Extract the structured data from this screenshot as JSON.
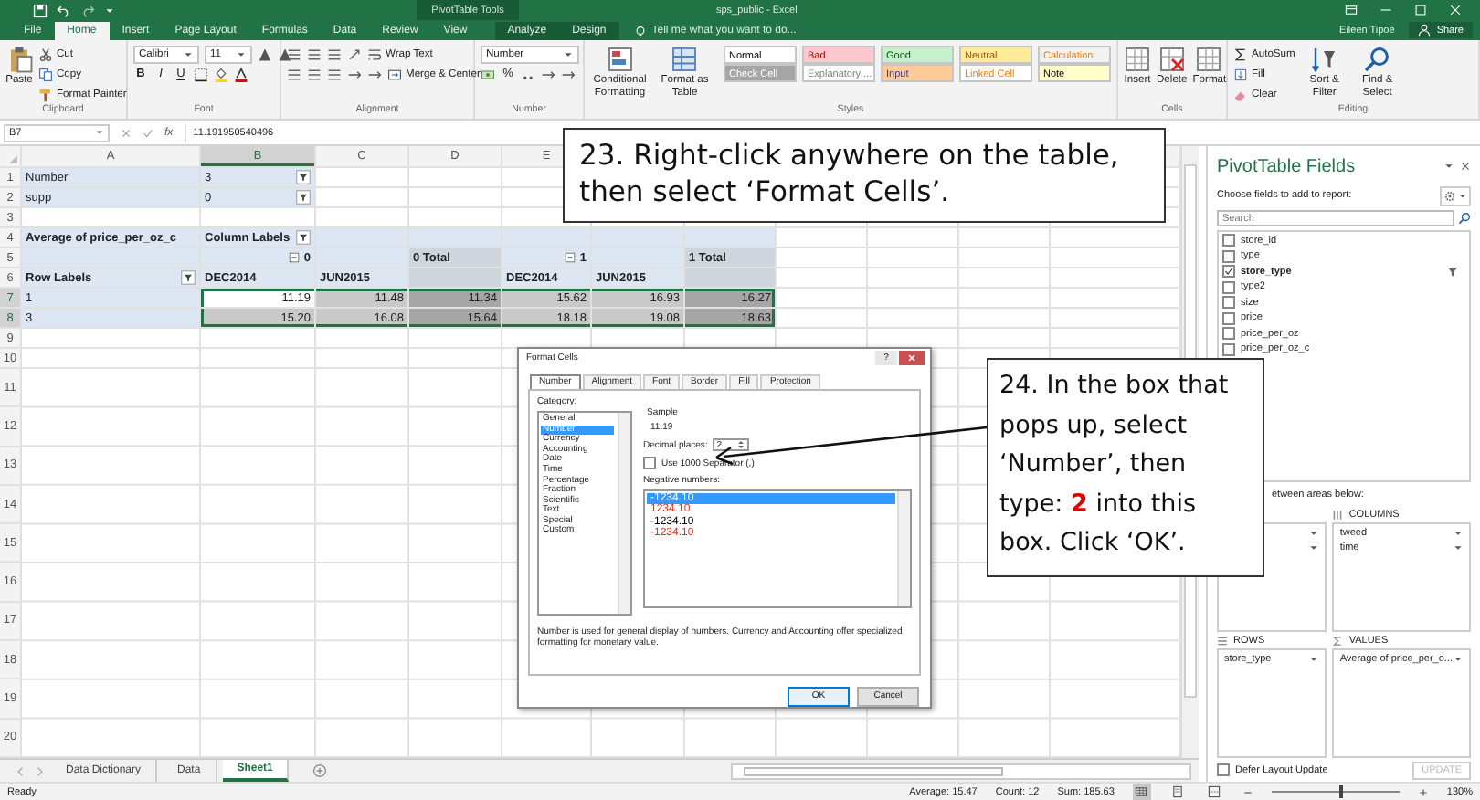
{
  "title_bar": {
    "title": "sps_public - Excel",
    "context": "PivotTable Tools"
  },
  "tabs": [
    {
      "label": "File",
      "selected": false,
      "contextual": false
    },
    {
      "label": "Home",
      "selected": true,
      "contextual": false
    },
    {
      "label": "Insert",
      "selected": false,
      "contextual": false
    },
    {
      "label": "Page Layout",
      "selected": false,
      "contextual": false
    },
    {
      "label": "Formulas",
      "selected": false,
      "contextual": false
    },
    {
      "label": "Data",
      "selected": false,
      "contextual": false
    },
    {
      "label": "Review",
      "selected": false,
      "contextual": false
    },
    {
      "label": "View",
      "selected": false,
      "contextual": false
    },
    {
      "label": "Analyze",
      "selected": false,
      "contextual": true
    },
    {
      "label": "Design",
      "selected": false,
      "contextual": true
    }
  ],
  "tell_me": {
    "placeholder": "Tell me what you want to do..."
  },
  "account": {
    "user": "Eileen Tipoe",
    "share": "Share"
  },
  "ribbon": [
    {
      "label": "Clipboard",
      "blocks": [
        {
          "kind": "big",
          "label": "Paste"
        },
        {
          "kind": "stack",
          "rows": [
            {
              "controls": [
                {
                  "kind": "button",
                  "label": "Cut"
                }
              ]
            },
            {
              "controls": [
                {
                  "kind": "button",
                  "label": "Copy"
                }
              ]
            },
            {
              "controls": [
                {
                  "kind": "button",
                  "label": "Format Painter"
                }
              ]
            }
          ]
        }
      ]
    },
    {
      "label": "Font",
      "blocks": [
        {
          "kind": "stack",
          "rows": [
            {
              "controls": [
                {
                  "kind": "dropdown",
                  "label": "Calibri"
                },
                {
                  "kind": "dropdown",
                  "label": "11"
                },
                {
                  "kind": "tool"
                },
                {
                  "kind": "tool"
                }
              ]
            },
            {
              "controls": [
                {
                  "kind": "glyph",
                  "label": "B"
                },
                {
                  "kind": "glyph",
                  "label": "I"
                },
                {
                  "kind": "glyph",
                  "label": "U"
                },
                {
                  "kind": "tool"
                },
                {
                  "kind": "tool"
                },
                {
                  "kind": "tool"
                }
              ]
            }
          ]
        }
      ]
    },
    {
      "label": "Alignment",
      "blocks": [
        {
          "kind": "stack",
          "rows": [
            {
              "controls": [
                {
                  "kind": "tool"
                },
                {
                  "kind": "tool"
                },
                {
                  "kind": "tool"
                },
                {
                  "kind": "tool"
                },
                {
                  "kind": "button",
                  "label": "Wrap Text"
                }
              ]
            },
            {
              "controls": [
                {
                  "kind": "tool"
                },
                {
                  "kind": "tool"
                },
                {
                  "kind": "tool"
                },
                {
                  "kind": "tool"
                },
                {
                  "kind": "tool"
                },
                {
                  "kind": "button",
                  "label": "Merge & Center"
                }
              ]
            }
          ]
        }
      ]
    },
    {
      "label": "Number",
      "blocks": [
        {
          "kind": "stack",
          "rows": [
            {
              "controls": [
                {
                  "kind": "dropdown",
                  "label": "Number"
                }
              ]
            },
            {
              "controls": [
                {
                  "kind": "tool"
                },
                {
                  "kind": "glyph",
                  "label": "%"
                },
                {
                  "kind": "tool"
                },
                {
                  "kind": "tool"
                },
                {
                  "kind": "tool"
                }
              ]
            }
          ]
        }
      ]
    },
    {
      "label": "Styles",
      "blocks": [
        {
          "kind": "big",
          "label": "Conditional Formatting"
        },
        {
          "kind": "big",
          "label": "Format as Table"
        },
        {
          "kind": "stack",
          "rows": [
            {
              "controls": [
                {
                  "kind": "style",
                  "label": "Normal",
                  "color": "#ffffff"
                },
                {
                  "kind": "style",
                  "label": "Bad",
                  "color": "#ffc7ce"
                },
                {
                  "kind": "style",
                  "label": "Good",
                  "color": "#c6efce"
                },
                {
                  "kind": "style",
                  "label": "Neutral",
                  "color": "#ffeb9c"
                },
                {
                  "kind": "style",
                  "label": "Calculation",
                  "color": "#f2f2f2"
                }
              ]
            },
            {
              "controls": [
                {
                  "kind": "style",
                  "label": "Check Cell",
                  "color": "#a5a5a5"
                },
                {
                  "kind": "style",
                  "label": "Explanatory ...",
                  "color": "#ffffff"
                },
                {
                  "kind": "style",
                  "label": "Input",
                  "color": "#ffcc99"
                },
                {
                  "kind": "style",
                  "label": "Linked Cell",
                  "color": "#ffffff"
                },
                {
                  "kind": "style",
                  "label": "Note",
                  "color": "#ffffcc"
                }
              ]
            }
          ]
        }
      ]
    },
    {
      "label": "Cells",
      "blocks": [
        {
          "kind": "big",
          "label": "Insert"
        },
        {
          "kind": "big",
          "label": "Delete"
        },
        {
          "kind": "big",
          "label": "Format"
        }
      ]
    },
    {
      "label": "Editing",
      "blocks": [
        {
          "kind": "stack",
          "rows": [
            {
              "controls": [
                {
                  "kind": "button",
                  "label": "AutoSum"
                }
              ]
            },
            {
              "controls": [
                {
                  "kind": "button",
                  "label": "Fill"
                }
              ]
            },
            {
              "controls": [
                {
                  "kind": "button",
                  "label": "Clear"
                }
              ]
            }
          ]
        },
        {
          "kind": "big",
          "label": "Sort & Filter"
        },
        {
          "kind": "big",
          "label": "Find & Select"
        }
      ]
    }
  ],
  "sheet": {
    "name_box": "B7",
    "function_label": "fx",
    "formula": "11.191950540496",
    "columns": [
      {
        "label": "A",
        "selected": false
      },
      {
        "label": "B",
        "selected": true
      },
      {
        "label": "C",
        "selected": false
      },
      {
        "label": "D",
        "selected": false
      },
      {
        "label": "E",
        "selected": false
      }
    ],
    "rows": [
      {
        "number": "1",
        "selected": false,
        "cells": [
          {
            "kind": "label",
            "text": "Number"
          },
          {
            "kind": "filter-value",
            "text": "3"
          }
        ]
      },
      {
        "number": "2",
        "selected": false,
        "cells": [
          {
            "kind": "label",
            "text": "supp"
          },
          {
            "kind": "filter-value",
            "text": "0"
          }
        ]
      },
      {
        "number": "3",
        "selected": false
      },
      {
        "number": "4",
        "selected": false,
        "cells": [
          {
            "kind": "heading",
            "text": "Average of price_per_oz_c"
          },
          {
            "kind": "heading-filter",
            "text": "Column Labels"
          },
          {
            "kind": "band"
          },
          {
            "kind": "band"
          },
          {
            "kind": "band"
          },
          {
            "kind": "band"
          },
          {
            "kind": "band"
          }
        ]
      },
      {
        "number": "5",
        "selected": false,
        "cells": [
          {
            "kind": "band"
          },
          {
            "kind": "group",
            "text": "0"
          },
          {
            "kind": "band"
          },
          {
            "kind": "total-heading",
            "text": "0 Total"
          },
          {
            "kind": "group",
            "text": "1"
          },
          {
            "kind": "band"
          },
          {
            "kind": "total-heading",
            "text": "1 Total"
          }
        ]
      },
      {
        "number": "6",
        "selected": false,
        "cells": [
          {
            "kind": "heading-filter",
            "text": "Row Labels"
          },
          {
            "kind": "heading",
            "text": "DEC2014"
          },
          {
            "kind": "heading",
            "text": "JUN2015"
          },
          {
            "kind": "total-band"
          },
          {
            "kind": "heading",
            "text": "DEC2014"
          },
          {
            "kind": "heading",
            "text": "JUN2015"
          },
          {
            "kind": "total-band"
          }
        ]
      },
      {
        "number": "7",
        "selected": true,
        "cells": [
          {
            "kind": "label",
            "text": "1"
          },
          {
            "kind": "current",
            "text": "11.19"
          },
          {
            "kind": "value",
            "text": "11.48"
          },
          {
            "kind": "total",
            "text": "11.34"
          },
          {
            "kind": "value",
            "text": "15.62"
          },
          {
            "kind": "value",
            "text": "16.93"
          },
          {
            "kind": "total",
            "text": "16.27"
          }
        ]
      },
      {
        "number": "8",
        "selected": true,
        "cells": [
          {
            "kind": "label",
            "text": "3"
          },
          {
            "kind": "value",
            "text": "15.20"
          },
          {
            "kind": "value",
            "text": "16.08"
          },
          {
            "kind": "total",
            "text": "15.64"
          },
          {
            "kind": "value",
            "text": "18.18"
          },
          {
            "kind": "value",
            "text": "19.08"
          },
          {
            "kind": "total",
            "text": "18.63"
          }
        ]
      },
      {
        "number": "9",
        "selected": false
      },
      {
        "number": "10",
        "selected": false
      },
      {
        "number": "11",
        "selected": false
      },
      {
        "number": "12",
        "selected": false
      },
      {
        "number": "13",
        "selected": false
      },
      {
        "number": "14",
        "selected": false
      },
      {
        "number": "15",
        "selected": false
      },
      {
        "number": "16",
        "selected": false
      },
      {
        "number": "17",
        "selected": false
      },
      {
        "number": "18",
        "selected": false
      },
      {
        "number": "19",
        "selected": false
      },
      {
        "number": "20",
        "selected": false
      }
    ]
  },
  "sheet_tabs": [
    {
      "label": "Data Dictionary",
      "selected": false
    },
    {
      "label": "Data",
      "selected": false
    },
    {
      "label": "Sheet1",
      "selected": true
    }
  ],
  "pivot_pane": {
    "title": "PivotTable Fields",
    "subtitle": "Choose fields to add to report:",
    "search": {
      "placeholder": "Search"
    },
    "fields": [
      {
        "label": "store_id",
        "checked": false,
        "filtered": false
      },
      {
        "label": "type",
        "checked": false,
        "filtered": false
      },
      {
        "label": "store_type",
        "checked": true,
        "filtered": true
      },
      {
        "label": "type2",
        "checked": false,
        "filtered": false
      },
      {
        "label": "size",
        "checked": false,
        "filtered": false
      },
      {
        "label": "price",
        "checked": false,
        "filtered": false
      },
      {
        "label": "price_per_oz",
        "checked": false,
        "filtered": false
      },
      {
        "label": "price_per_oz_c",
        "checked": false,
        "filtered": false
      }
    ],
    "drag_hint": "etween areas below:",
    "areas": [
      {
        "kind": "filters",
        "items": [
          {
            "kind": "hidden"
          },
          {
            "kind": "hidden"
          }
        ]
      },
      {
        "kind": "columns",
        "label": "COLUMNS",
        "items": [
          {
            "kind": "field",
            "label": "tweed"
          },
          {
            "kind": "field",
            "label": "time"
          }
        ]
      },
      {
        "kind": "rows",
        "label": "ROWS",
        "items": [
          {
            "kind": "field",
            "label": "store_type"
          }
        ]
      },
      {
        "kind": "values",
        "label": "VALUES",
        "items": [
          {
            "kind": "field",
            "label": "Average of price_per_o..."
          }
        ]
      }
    ],
    "defer": {
      "label": "Defer Layout Update",
      "checked": false
    },
    "update": {
      "label": "UPDATE",
      "disabled": true
    }
  },
  "status_bar": {
    "state": "Ready",
    "stats": [
      "Average: 15.47",
      "Count: 12",
      "Sum: 185.63"
    ],
    "views": [
      {
        "selected": true
      },
      {
        "selected": false
      },
      {
        "selected": false
      }
    ],
    "zoom": {
      "level": 0.55,
      "reading": "130%"
    }
  },
  "dialog": {
    "title": "Format Cells",
    "help": "?",
    "tabs": [
      {
        "label": "Number",
        "selected": true
      },
      {
        "label": "Alignment",
        "selected": false
      },
      {
        "label": "Font",
        "selected": false
      },
      {
        "label": "Border",
        "selected": false
      },
      {
        "label": "Fill",
        "selected": false
      },
      {
        "label": "Protection",
        "selected": false
      }
    ],
    "category_label": "Category:",
    "categories": [
      {
        "label": "General",
        "selected": false
      },
      {
        "label": "Number",
        "selected": true
      },
      {
        "label": "Currency",
        "selected": false
      },
      {
        "label": "Accounting",
        "selected": false
      },
      {
        "label": "Date",
        "selected": false
      },
      {
        "label": "Time",
        "selected": false
      },
      {
        "label": "Percentage",
        "selected": false
      },
      {
        "label": "Fraction",
        "selected": false
      },
      {
        "label": "Scientific",
        "selected": false
      },
      {
        "label": "Text",
        "selected": false
      },
      {
        "label": "Special",
        "selected": false
      },
      {
        "label": "Custom",
        "selected": false
      }
    ],
    "sample_label": "Sample",
    "sample": "11.19",
    "decimal_label": "Decimal places:",
    "decimal_value": "2",
    "separator": {
      "label": "Use 1000 Separator (,)",
      "checked": false
    },
    "negative_label": "Negative numbers:",
    "negatives": [
      {
        "label": "-1234.10",
        "selected": true
      },
      {
        "label": "1234.10",
        "selected": false,
        "color": "#e0301e"
      },
      {
        "label": "-1234.10",
        "selected": false
      },
      {
        "label": "-1234.10",
        "selected": false,
        "color": "#e0301e"
      }
    ],
    "description": "Number is used for general display of numbers.  Currency and Accounting offer specialized formatting for monetary value.",
    "buttons": [
      {
        "label": "OK",
        "default": true
      },
      {
        "label": "Cancel",
        "default": false
      }
    ]
  },
  "callouts": [
    {
      "text": "23. Right-click anywhere on the table, then select ‘Format Cells’."
    },
    {
      "text": "24. In the box that pops up, select ‘Number’, then type: **2** into this box. Click ‘OK’."
    }
  ]
}
